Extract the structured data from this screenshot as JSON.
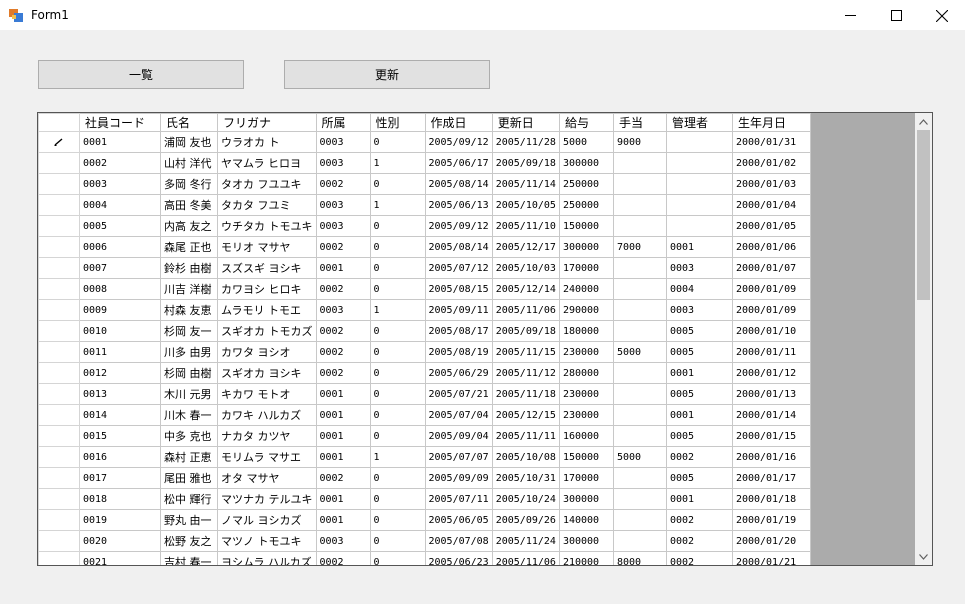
{
  "window": {
    "title": "Form1",
    "min_icon": "minimize-icon",
    "max_icon": "maximize-icon",
    "close_icon": "close-icon"
  },
  "buttons": {
    "list_label": "一覧",
    "update_label": "更新"
  },
  "grid": {
    "columns": [
      "社員コード",
      "氏名",
      "フリガナ",
      "所属",
      "性別",
      "作成日",
      "更新日",
      "給与",
      "手当",
      "管理者",
      "生年月日"
    ],
    "rows": [
      [
        "0001",
        "浦岡 友也",
        "ウラオカ ト",
        "0003",
        "0",
        "2005/09/12",
        "2005/11/28",
        "5000",
        "9000",
        "",
        "2000/01/31"
      ],
      [
        "0002",
        "山村 洋代",
        "ヤマムラ ヒロヨ",
        "0003",
        "1",
        "2005/06/17",
        "2005/09/18",
        "300000",
        "",
        "",
        "2000/01/02"
      ],
      [
        "0003",
        "多岡 冬行",
        "タオカ フユユキ",
        "0002",
        "0",
        "2005/08/14",
        "2005/11/14",
        "250000",
        "",
        "",
        "2000/01/03"
      ],
      [
        "0004",
        "高田 冬美",
        "タカタ フユミ",
        "0003",
        "1",
        "2005/06/13",
        "2005/10/05",
        "250000",
        "",
        "",
        "2000/01/04"
      ],
      [
        "0005",
        "内高 友之",
        "ウチタカ トモユキ",
        "0003",
        "0",
        "2005/09/12",
        "2005/11/10",
        "150000",
        "",
        "",
        "2000/01/05"
      ],
      [
        "0006",
        "森尾 正也",
        "モリオ マサヤ",
        "0002",
        "0",
        "2005/08/14",
        "2005/12/17",
        "300000",
        "7000",
        "0001",
        "2000/01/06"
      ],
      [
        "0007",
        "鈴杉 由樹",
        "スズスギ ヨシキ",
        "0001",
        "0",
        "2005/07/12",
        "2005/10/03",
        "170000",
        "",
        "0003",
        "2000/01/07"
      ],
      [
        "0008",
        "川吉 洋樹",
        "カワヨシ ヒロキ",
        "0002",
        "0",
        "2005/08/15",
        "2005/12/14",
        "240000",
        "",
        "0004",
        "2000/01/09"
      ],
      [
        "0009",
        "村森 友恵",
        "ムラモリ トモエ",
        "0003",
        "1",
        "2005/09/11",
        "2005/11/06",
        "290000",
        "",
        "0003",
        "2000/01/09"
      ],
      [
        "0010",
        "杉岡 友一",
        "スギオカ トモカズ",
        "0002",
        "0",
        "2005/08/17",
        "2005/09/18",
        "180000",
        "",
        "0005",
        "2000/01/10"
      ],
      [
        "0011",
        "川多 由男",
        "カワタ ヨシオ",
        "0002",
        "0",
        "2005/08/19",
        "2005/11/15",
        "230000",
        "5000",
        "0005",
        "2000/01/11"
      ],
      [
        "0012",
        "杉岡 由樹",
        "スギオカ ヨシキ",
        "0002",
        "0",
        "2005/06/29",
        "2005/11/12",
        "280000",
        "",
        "0001",
        "2000/01/12"
      ],
      [
        "0013",
        "木川 元男",
        "キカワ モトオ",
        "0001",
        "0",
        "2005/07/21",
        "2005/11/18",
        "230000",
        "",
        "0005",
        "2000/01/13"
      ],
      [
        "0014",
        "川木 春一",
        "カワキ ハルカズ",
        "0001",
        "0",
        "2005/07/04",
        "2005/12/15",
        "230000",
        "",
        "0001",
        "2000/01/14"
      ],
      [
        "0015",
        "中多 克也",
        "ナカタ カツヤ",
        "0001",
        "0",
        "2005/09/04",
        "2005/11/11",
        "160000",
        "",
        "0005",
        "2000/01/15"
      ],
      [
        "0016",
        "森村 正恵",
        "モリムラ マサエ",
        "0001",
        "1",
        "2005/07/07",
        "2005/10/08",
        "150000",
        "5000",
        "0002",
        "2000/01/16"
      ],
      [
        "0017",
        "尾田 雅也",
        "オタ マサヤ",
        "0002",
        "0",
        "2005/09/09",
        "2005/10/31",
        "170000",
        "",
        "0005",
        "2000/01/17"
      ],
      [
        "0018",
        "松中 輝行",
        "マツナカ テルユキ",
        "0001",
        "0",
        "2005/07/11",
        "2005/10/24",
        "300000",
        "",
        "0001",
        "2000/01/18"
      ],
      [
        "0019",
        "野丸 由一",
        "ノマル ヨシカズ",
        "0001",
        "0",
        "2005/06/05",
        "2005/09/26",
        "140000",
        "",
        "0002",
        "2000/01/19"
      ],
      [
        "0020",
        "松野 友之",
        "マツノ トモユキ",
        "0003",
        "0",
        "2005/07/08",
        "2005/11/24",
        "300000",
        "",
        "0002",
        "2000/01/20"
      ],
      [
        "0021",
        "吉村 春一",
        "ヨシムラ ハルカズ",
        "0002",
        "0",
        "2005/06/23",
        "2005/11/06",
        "210000",
        "8000",
        "0002",
        "2000/01/21"
      ]
    ]
  },
  "colors": {
    "window_bg": "#f0f0f0",
    "grid_bg": "#ababab",
    "button_bg": "#e1e1e1"
  }
}
